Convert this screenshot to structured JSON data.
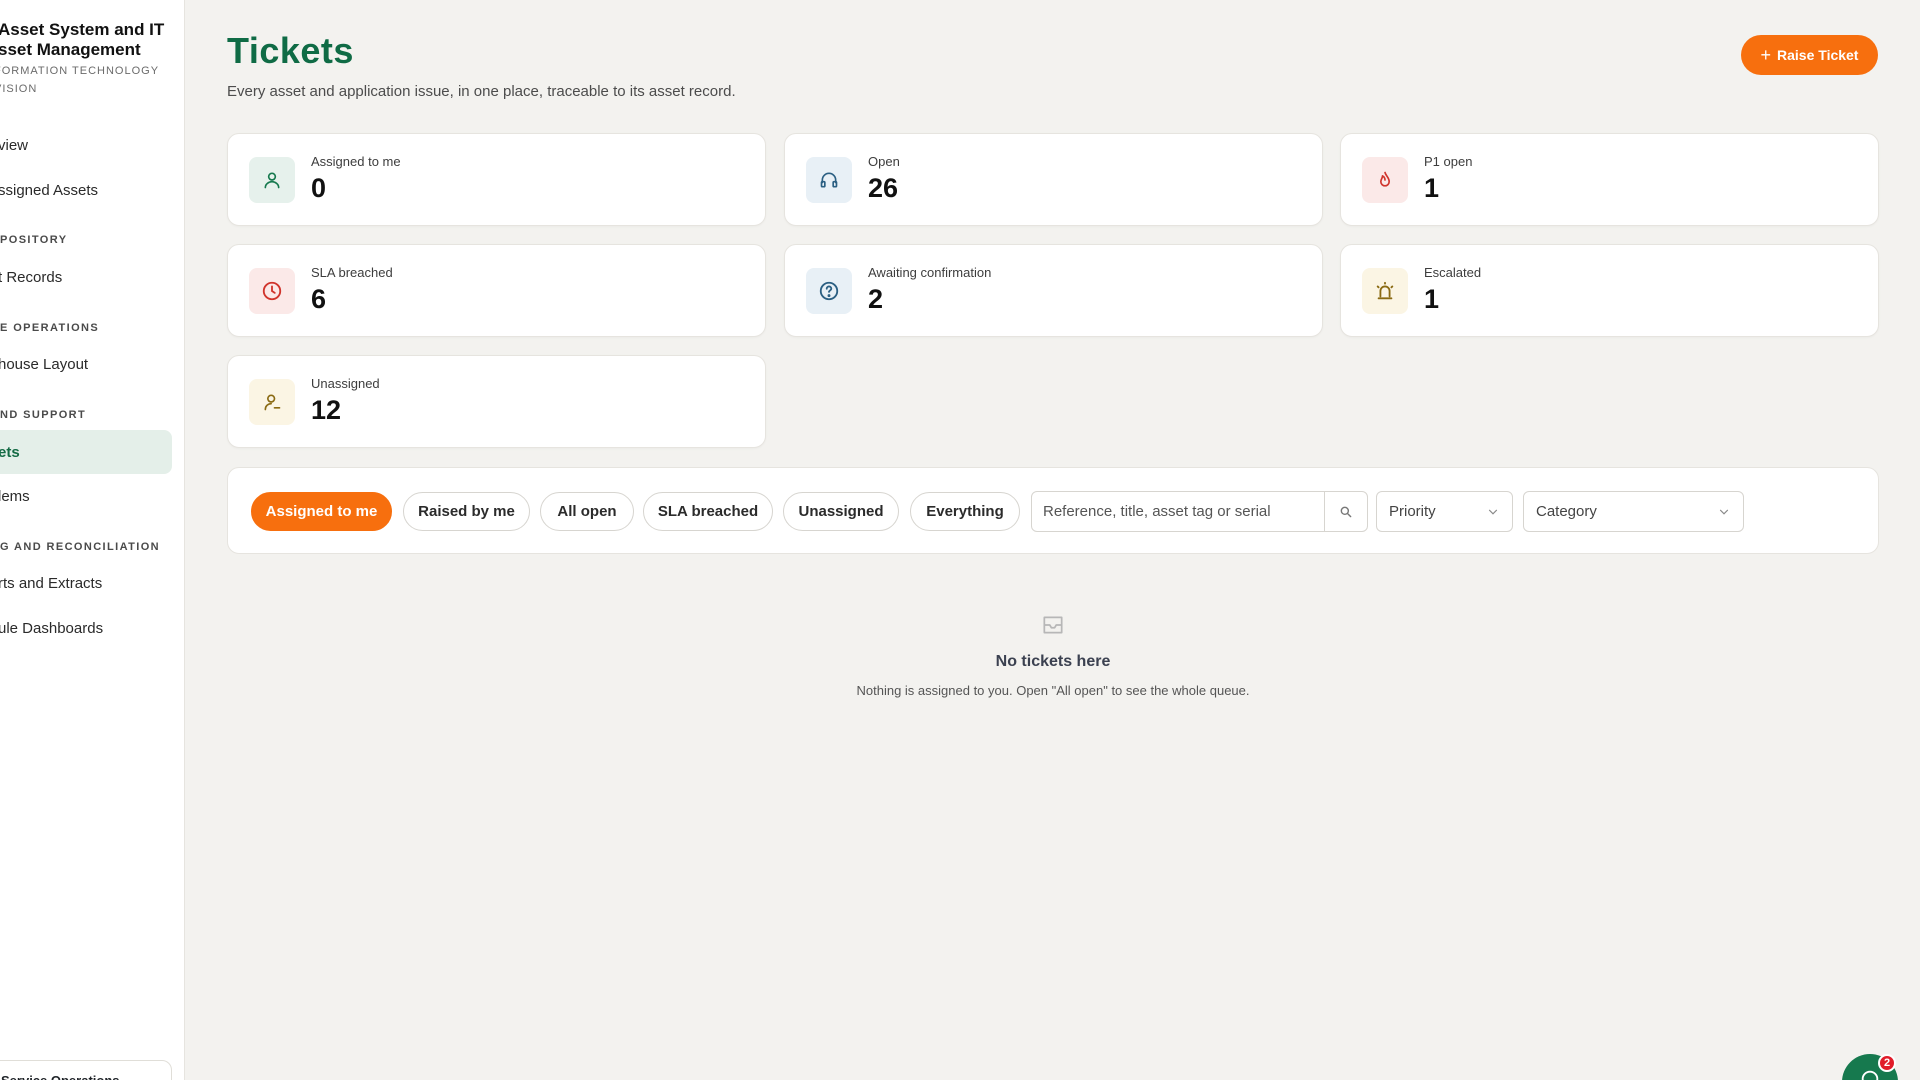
{
  "sidebar": {
    "brand_title_1": "Asset System and IT",
    "brand_title_2": "sset Management",
    "brand_sub_1": "FORMATION TECHNOLOGY",
    "brand_sub_2": "VISION",
    "overview": "view",
    "assigned_assets": "ssigned Assets",
    "section_repository": "POSITORY",
    "asset_records": "t Records",
    "section_warehouse": "E OPERATIONS",
    "warehouse_layout": "house Layout",
    "section_support": "ND SUPPORT",
    "tickets": "ets",
    "problems": "lems",
    "section_reports": "G AND RECONCILIATION",
    "reports": "rts and Extracts",
    "dashboards": "ule Dashboards",
    "ops_card": "Service Operations"
  },
  "header": {
    "title": "Tickets",
    "subtitle": "Every asset and application issue, in one place, traceable to its asset record.",
    "raise_button": "Raise Ticket"
  },
  "stats": [
    {
      "label": "Assigned to me",
      "value": "0",
      "icon": "user-icon"
    },
    {
      "label": "Open",
      "value": "26",
      "icon": "headset-icon"
    },
    {
      "label": "P1 open",
      "value": "1",
      "icon": "flame-icon"
    },
    {
      "label": "SLA breached",
      "value": "6",
      "icon": "clock-icon"
    },
    {
      "label": "Awaiting confirmation",
      "value": "2",
      "icon": "question-icon"
    },
    {
      "label": "Escalated",
      "value": "1",
      "icon": "siren-icon"
    },
    {
      "label": "Unassigned",
      "value": "12",
      "icon": "user-minus-icon"
    }
  ],
  "filters": {
    "chips": [
      "Assigned to me",
      "Raised by me",
      "All open",
      "SLA breached",
      "Unassigned",
      "Everything"
    ],
    "active_chip": "Assigned to me",
    "search_placeholder": "Reference, title, asset tag or serial",
    "priority_label": "Priority",
    "category_label": "Category"
  },
  "empty_state": {
    "title": "No tickets here",
    "message": "Nothing is assigned to you. Open \"All open\" to see the whole queue."
  },
  "chat": {
    "badge_count": "2"
  },
  "colors": {
    "brand_green": "#0f6b45",
    "accent_orange": "#f76f0e"
  }
}
